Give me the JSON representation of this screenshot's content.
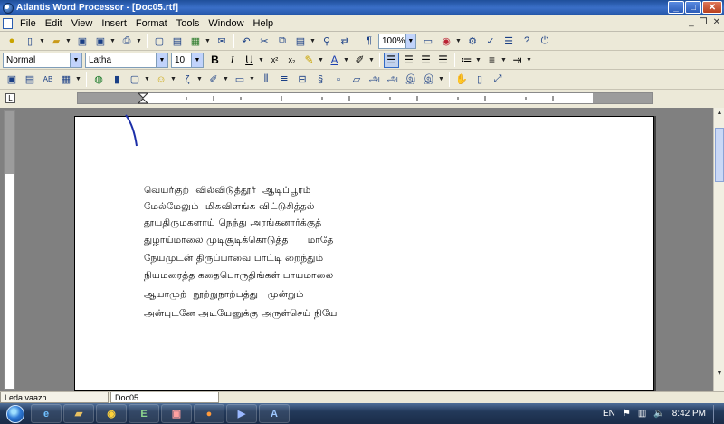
{
  "window": {
    "title": "Atlantis Word Processor - [Doc05.rtf]"
  },
  "menu": [
    "File",
    "Edit",
    "View",
    "Insert",
    "Format",
    "Tools",
    "Window",
    "Help"
  ],
  "toolbar1": {
    "zoom": "100%"
  },
  "format_bar": {
    "style": "Normal",
    "font": "Latha",
    "size": "10"
  },
  "document": {
    "lines": [
      "வெயர்குற்  வில்விடுத்தூர்  ஆடிப்பூரம்",
      "மேல்மேலும்  மிகவிளங்க விட்டுசித்தல்",
      "தூயதிருமகளாய் நெந்து அரங்கனார்க்குத்",
      "துழாய்மாலை முடிசூடிக்கொடுத்த      மாதே",
      "நேயமுடன் திருப்பாவை பாட்டி றைந்தும்",
      "நியமரைத்த கதைபொருதிங்கள் பாயமாலை",
      "ஆயாமுற்  நூற்றுநாற்பத்து   முன்றும்",
      "அன்புடனே அடியேனுக்கு அருள்செய் நியே"
    ]
  },
  "doc_tabs": [
    "Leda vaazh",
    "Doc05"
  ],
  "taskbar": {
    "language": "EN",
    "clock": "8:42 PM"
  }
}
